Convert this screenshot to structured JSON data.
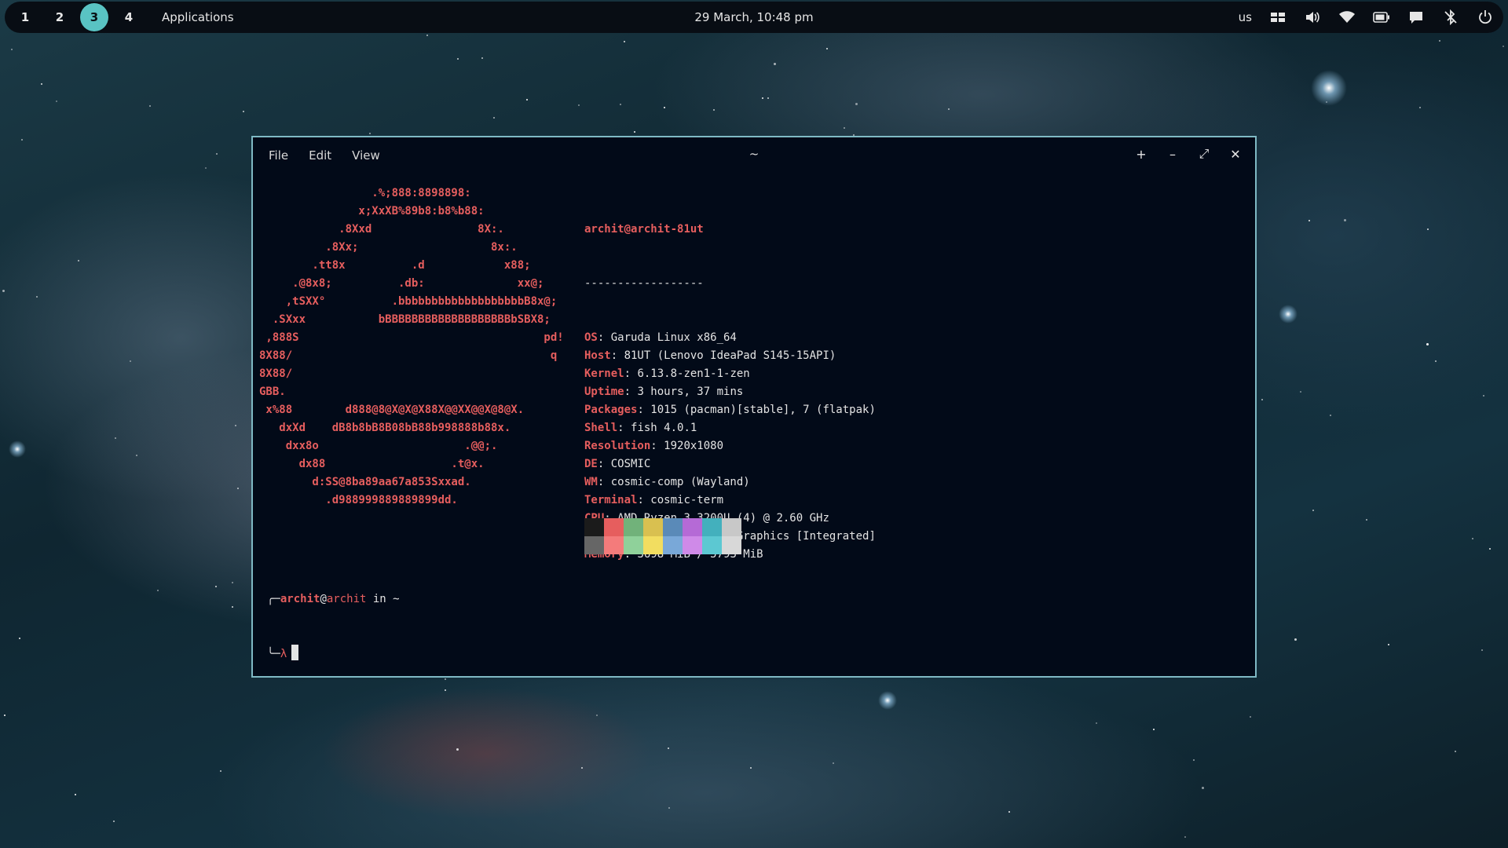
{
  "panel": {
    "workspaces": [
      "1",
      "2",
      "3",
      "4"
    ],
    "active_workspace": "3",
    "applications_label": "Applications",
    "clock": "29 March, 10:48 pm",
    "keyboard_layout": "us",
    "tray_icons": [
      "workspaces-icon",
      "volume-icon",
      "wifi-icon",
      "battery-icon",
      "notifications-icon",
      "bluetooth-off-icon",
      "power-icon"
    ]
  },
  "terminal": {
    "menu": [
      "File",
      "Edit",
      "View"
    ],
    "title": "~",
    "controls": {
      "new_tab": "+",
      "minimize": "–",
      "maximize": "⤢",
      "close": "✕"
    },
    "logo_lines": [
      "                 .%;888:8898898:",
      "               x;XxXB%89b8:b8%b88:",
      "            .8Xxd                8X:.",
      "          .8Xx;                    8x:.",
      "        .tt8x          .d            x88;",
      "     .@8x8;          .db:              xx@;",
      "    ,tSXX°          .bbbbbbbbbbbbbbbbbbbB8x@;",
      "  .SXxx           bBBBBBBBBBBBBBBBBBBBbSBX8;",
      " ,888S                                     pd!",
      "8X88/                                       q",
      "8X88/",
      "GBB.",
      " x%88        d888@8@X@X@X88X@@XX@@X@8@X.",
      "   dxXd    dB8b8bB8B08bB88b998888b88x.",
      "    dxx8o                      .@@;.",
      "      dx88                   .t@x.",
      "        d:SS@8ba89aa67a853Sxxad.",
      "          .d988999889889899dd."
    ],
    "user": "archit",
    "host_full": "archit-81ut",
    "separator": "------------------",
    "info": [
      {
        "key": "OS",
        "value": "Garuda Linux x86_64"
      },
      {
        "key": "Host",
        "value": "81UT (Lenovo IdeaPad S145-15API)"
      },
      {
        "key": "Kernel",
        "value": "6.13.8-zen1-1-zen"
      },
      {
        "key": "Uptime",
        "value": "3 hours, 37 mins"
      },
      {
        "key": "Packages",
        "value": "1015 (pacman)[stable], 7 (flatpak)"
      },
      {
        "key": "Shell",
        "value": "fish 4.0.1"
      },
      {
        "key": "Resolution",
        "value": "1920x1080"
      },
      {
        "key": "DE",
        "value": "COSMIC"
      },
      {
        "key": "WM",
        "value": "cosmic-comp (Wayland)"
      },
      {
        "key": "Terminal",
        "value": "cosmic-term"
      },
      {
        "key": "CPU",
        "value": "AMD Ryzen 3 3200U (4) @ 2.60 GHz"
      },
      {
        "key": "GPU",
        "value": "AMD Radeon Vega 3 Graphics [Integrated]"
      },
      {
        "key": "Memory",
        "value": "3698 MiB / 5793 MiB"
      }
    ],
    "palette_colors": [
      "#1b1b1b",
      "#e65e5e",
      "#71b27a",
      "#d9c050",
      "#5a8ab8",
      "#b56ad6",
      "#43b0bd",
      "#c8c8c8",
      "#666666",
      "#f47b7b",
      "#8fd19a",
      "#f2dd60",
      "#79a8d8",
      "#cf8ae8",
      "#5cc8d2",
      "#d8d8d8"
    ],
    "prompt": {
      "line1_prefix": "╭─",
      "user": "archit",
      "at": "@",
      "host": "archit",
      "in": " in ",
      "dir": "~",
      "line2_prefix": "╰─",
      "symbol": "λ"
    }
  }
}
